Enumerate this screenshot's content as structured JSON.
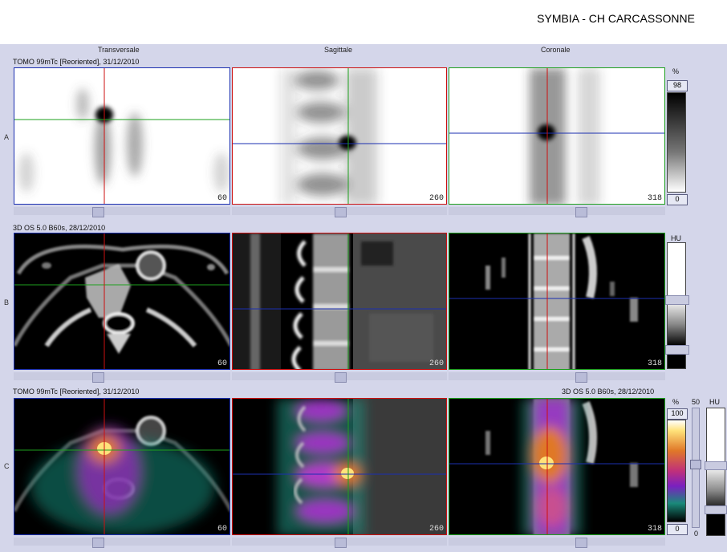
{
  "header": {
    "title": "SYMBIA - CH CARCASSONNE"
  },
  "columns": [
    "Transversale",
    "Sagittale",
    "Coronale"
  ],
  "rows": {
    "a": {
      "label": "A",
      "info": "TOMO 99mTc [Reoriented], 31/12/2010",
      "slices": [
        "60",
        "260",
        "318"
      ]
    },
    "b": {
      "label": "B",
      "info": "3D  OS  5.0  B60s, 28/12/2010",
      "slices": [
        "60",
        "260",
        "318"
      ]
    },
    "c": {
      "label": "C",
      "info_left": "TOMO 99mTc [Reoriented], 31/12/2010",
      "info_right": "3D  OS  5.0  B60s, 28/12/2010",
      "slices": [
        "60",
        "260",
        "318"
      ]
    }
  },
  "scales": {
    "a": {
      "unit": "%",
      "max": "98",
      "min": "0"
    },
    "b": {
      "unit": "HU"
    },
    "c": {
      "unit_pct": "%",
      "pct_max": "100",
      "pct_min": "0",
      "fusion_value": "50",
      "fusion_min": "0",
      "unit_hu": "HU"
    }
  },
  "colors": {
    "red": "#cc1010",
    "green": "#1ea01e",
    "blue": "#1b2fb0",
    "fusion_hot": "#ffe27a"
  }
}
